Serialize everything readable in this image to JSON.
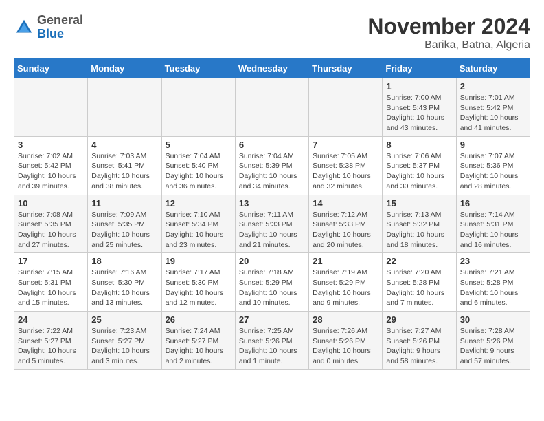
{
  "header": {
    "logo": {
      "general": "General",
      "blue": "Blue"
    },
    "title": "November 2024",
    "subtitle": "Barika, Batna, Algeria"
  },
  "calendar": {
    "days_of_week": [
      "Sunday",
      "Monday",
      "Tuesday",
      "Wednesday",
      "Thursday",
      "Friday",
      "Saturday"
    ],
    "weeks": [
      [
        {
          "day": "",
          "info": ""
        },
        {
          "day": "",
          "info": ""
        },
        {
          "day": "",
          "info": ""
        },
        {
          "day": "",
          "info": ""
        },
        {
          "day": "",
          "info": ""
        },
        {
          "day": "1",
          "info": "Sunrise: 7:00 AM\nSunset: 5:43 PM\nDaylight: 10 hours\nand 43 minutes."
        },
        {
          "day": "2",
          "info": "Sunrise: 7:01 AM\nSunset: 5:42 PM\nDaylight: 10 hours\nand 41 minutes."
        }
      ],
      [
        {
          "day": "3",
          "info": "Sunrise: 7:02 AM\nSunset: 5:42 PM\nDaylight: 10 hours\nand 39 minutes."
        },
        {
          "day": "4",
          "info": "Sunrise: 7:03 AM\nSunset: 5:41 PM\nDaylight: 10 hours\nand 38 minutes."
        },
        {
          "day": "5",
          "info": "Sunrise: 7:04 AM\nSunset: 5:40 PM\nDaylight: 10 hours\nand 36 minutes."
        },
        {
          "day": "6",
          "info": "Sunrise: 7:04 AM\nSunset: 5:39 PM\nDaylight: 10 hours\nand 34 minutes."
        },
        {
          "day": "7",
          "info": "Sunrise: 7:05 AM\nSunset: 5:38 PM\nDaylight: 10 hours\nand 32 minutes."
        },
        {
          "day": "8",
          "info": "Sunrise: 7:06 AM\nSunset: 5:37 PM\nDaylight: 10 hours\nand 30 minutes."
        },
        {
          "day": "9",
          "info": "Sunrise: 7:07 AM\nSunset: 5:36 PM\nDaylight: 10 hours\nand 28 minutes."
        }
      ],
      [
        {
          "day": "10",
          "info": "Sunrise: 7:08 AM\nSunset: 5:35 PM\nDaylight: 10 hours\nand 27 minutes."
        },
        {
          "day": "11",
          "info": "Sunrise: 7:09 AM\nSunset: 5:35 PM\nDaylight: 10 hours\nand 25 minutes."
        },
        {
          "day": "12",
          "info": "Sunrise: 7:10 AM\nSunset: 5:34 PM\nDaylight: 10 hours\nand 23 minutes."
        },
        {
          "day": "13",
          "info": "Sunrise: 7:11 AM\nSunset: 5:33 PM\nDaylight: 10 hours\nand 21 minutes."
        },
        {
          "day": "14",
          "info": "Sunrise: 7:12 AM\nSunset: 5:33 PM\nDaylight: 10 hours\nand 20 minutes."
        },
        {
          "day": "15",
          "info": "Sunrise: 7:13 AM\nSunset: 5:32 PM\nDaylight: 10 hours\nand 18 minutes."
        },
        {
          "day": "16",
          "info": "Sunrise: 7:14 AM\nSunset: 5:31 PM\nDaylight: 10 hours\nand 16 minutes."
        }
      ],
      [
        {
          "day": "17",
          "info": "Sunrise: 7:15 AM\nSunset: 5:31 PM\nDaylight: 10 hours\nand 15 minutes."
        },
        {
          "day": "18",
          "info": "Sunrise: 7:16 AM\nSunset: 5:30 PM\nDaylight: 10 hours\nand 13 minutes."
        },
        {
          "day": "19",
          "info": "Sunrise: 7:17 AM\nSunset: 5:30 PM\nDaylight: 10 hours\nand 12 minutes."
        },
        {
          "day": "20",
          "info": "Sunrise: 7:18 AM\nSunset: 5:29 PM\nDaylight: 10 hours\nand 10 minutes."
        },
        {
          "day": "21",
          "info": "Sunrise: 7:19 AM\nSunset: 5:29 PM\nDaylight: 10 hours\nand 9 minutes."
        },
        {
          "day": "22",
          "info": "Sunrise: 7:20 AM\nSunset: 5:28 PM\nDaylight: 10 hours\nand 7 minutes."
        },
        {
          "day": "23",
          "info": "Sunrise: 7:21 AM\nSunset: 5:28 PM\nDaylight: 10 hours\nand 6 minutes."
        }
      ],
      [
        {
          "day": "24",
          "info": "Sunrise: 7:22 AM\nSunset: 5:27 PM\nDaylight: 10 hours\nand 5 minutes."
        },
        {
          "day": "25",
          "info": "Sunrise: 7:23 AM\nSunset: 5:27 PM\nDaylight: 10 hours\nand 3 minutes."
        },
        {
          "day": "26",
          "info": "Sunrise: 7:24 AM\nSunset: 5:27 PM\nDaylight: 10 hours\nand 2 minutes."
        },
        {
          "day": "27",
          "info": "Sunrise: 7:25 AM\nSunset: 5:26 PM\nDaylight: 10 hours\nand 1 minute."
        },
        {
          "day": "28",
          "info": "Sunrise: 7:26 AM\nSunset: 5:26 PM\nDaylight: 10 hours\nand 0 minutes."
        },
        {
          "day": "29",
          "info": "Sunrise: 7:27 AM\nSunset: 5:26 PM\nDaylight: 9 hours\nand 58 minutes."
        },
        {
          "day": "30",
          "info": "Sunrise: 7:28 AM\nSunset: 5:26 PM\nDaylight: 9 hours\nand 57 minutes."
        }
      ]
    ]
  }
}
